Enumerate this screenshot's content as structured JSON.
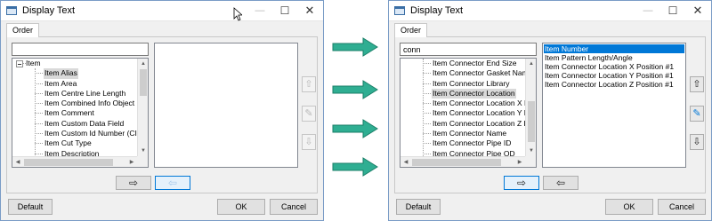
{
  "colors": {
    "accent": "#0078d7",
    "arrow_fill": "#2fae92",
    "arrow_stroke": "#1b7f68"
  },
  "left_dialog": {
    "title": "Display Text",
    "tab": "Order",
    "search_value": "",
    "tree": {
      "root": "Item",
      "items": [
        {
          "label": "Item Alias",
          "selected": true
        },
        {
          "label": "Item Area",
          "selected": false
        },
        {
          "label": "Item Centre Line Length",
          "selected": false
        },
        {
          "label": "Item Combined Info Object",
          "selected": false
        },
        {
          "label": "Item Comment",
          "selected": false
        },
        {
          "label": "Item Custom Data Field",
          "selected": false
        },
        {
          "label": "Item Custom Id Number (CID)",
          "selected": false
        },
        {
          "label": "Item Cut Type",
          "selected": false
        },
        {
          "label": "Item Description",
          "selected": false
        }
      ]
    },
    "selected_items": [],
    "buttons": {
      "default": "Default",
      "ok": "OK",
      "cancel": "Cancel"
    }
  },
  "right_dialog": {
    "title": "Display Text",
    "tab": "Order",
    "search_value": "conn",
    "tree": {
      "items": [
        {
          "label": "Item Connector End Size",
          "selected": false
        },
        {
          "label": "Item Connector Gasket Name",
          "selected": false
        },
        {
          "label": "Item Connector Library",
          "selected": false
        },
        {
          "label": "Item Connector Location",
          "selected": true
        },
        {
          "label": "Item Connector Location X Po",
          "selected": false
        },
        {
          "label": "Item Connector Location Y Po",
          "selected": false
        },
        {
          "label": "Item Connector Location Z Po",
          "selected": false
        },
        {
          "label": "Item Connector Name",
          "selected": false
        },
        {
          "label": "Item Connector Pipe ID",
          "selected": false
        },
        {
          "label": "Item Connector Pipe OD",
          "selected": false
        }
      ]
    },
    "selected_items": [
      {
        "label": "Item Number",
        "selected": true
      },
      {
        "label": "Item Pattern Length/Angle",
        "selected": false
      },
      {
        "label": "Item Connector Location X Position #1",
        "selected": false
      },
      {
        "label": "Item Connector Location Y Position #1",
        "selected": false
      },
      {
        "label": "Item Connector Location Z Position #1",
        "selected": false
      }
    ],
    "buttons": {
      "default": "Default",
      "ok": "OK",
      "cancel": "Cancel"
    }
  },
  "icons": {
    "minimize": "—",
    "maximize": "☐",
    "close": "✕",
    "move_up": "⇧",
    "move_down": "⇩",
    "add_right": "⇨",
    "remove_left": "⇦",
    "edit": "✎"
  }
}
